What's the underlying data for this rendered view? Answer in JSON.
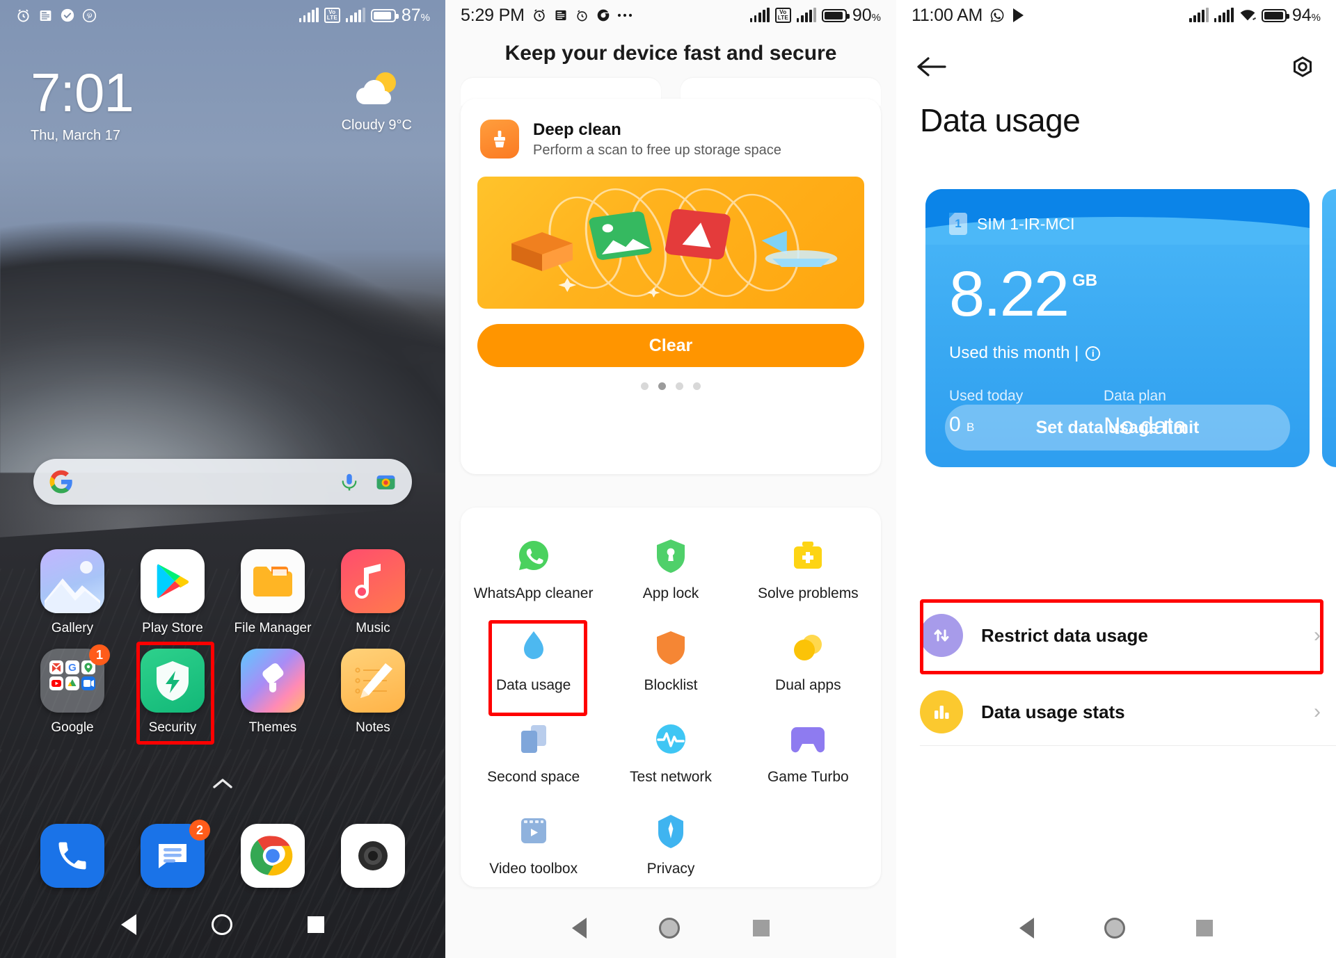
{
  "panel1": {
    "name": "home-screen",
    "statusbar": {
      "icons": [
        "alarm-icon",
        "news-icon",
        "check-circle-icon",
        "pinterest-icon"
      ],
      "signal1": "signal-bars-icon",
      "volte": "VoLTE",
      "volte_top": "Vo",
      "volte_bottom": "LTE",
      "signal2": "signal-bars-icon",
      "battery": "battery-icon",
      "battery_pct": "87",
      "pct_sign": "%"
    },
    "clock": {
      "time": "7:01",
      "date": "Thu, March 17"
    },
    "weather": {
      "condition": "Cloudy",
      "temp": "9°C",
      "label": "Cloudy  9°C",
      "icon": "partly-cloudy-icon"
    },
    "search": {
      "placeholder": "",
      "google_icon": "google-g-icon",
      "mic_icon": "microphone-icon",
      "lens_icon": "google-lens-icon"
    },
    "apps_row1": [
      {
        "label": "Gallery",
        "icon": "gallery-icon"
      },
      {
        "label": "Play Store",
        "icon": "play-store-icon"
      },
      {
        "label": "File Manager",
        "icon": "file-manager-icon"
      },
      {
        "label": "Music",
        "icon": "music-icon"
      }
    ],
    "apps_row2": [
      {
        "label": "Google",
        "icon": "google-folder-icon",
        "badge": "1"
      },
      {
        "label": "Security",
        "icon": "security-shield-icon",
        "highlight": true
      },
      {
        "label": "Themes",
        "icon": "themes-icon"
      },
      {
        "label": "Notes",
        "icon": "notes-icon"
      }
    ],
    "dock": [
      {
        "label": "Phone",
        "icon": "phone-icon"
      },
      {
        "label": "Messages",
        "icon": "messages-icon",
        "badge": "2"
      },
      {
        "label": "Chrome",
        "icon": "chrome-icon"
      },
      {
        "label": "Camera",
        "icon": "camera-icon"
      }
    ],
    "page_indicator_icon": "chevron-up-icon",
    "navbar": [
      "back-nav-icon",
      "home-nav-icon",
      "recents-nav-icon"
    ]
  },
  "panel2": {
    "name": "security-app",
    "statusbar": {
      "time": "5:29 PM",
      "icons": [
        "alarm-icon",
        "news-icon",
        "clock-icon",
        "chrome-icon",
        "more-dots-icon"
      ],
      "volte_top": "Vo",
      "volte_bottom": "LTE",
      "battery_pct": "90",
      "pct_sign": "%"
    },
    "header": "Keep your device fast and secure",
    "deep_clean": {
      "title": "Deep clean",
      "subtitle": "Perform a scan to free up storage space",
      "icon": "broom-icon",
      "banner_icon": "storage-files-banner",
      "button": "Clear",
      "pager_dots": 4,
      "pager_active_index": 1
    },
    "features_row1": [
      {
        "label": "WhatsApp cleaner",
        "icon": "whatsapp-icon"
      },
      {
        "label": "App lock",
        "icon": "app-lock-shield-icon"
      },
      {
        "label": "Solve problems",
        "icon": "first-aid-kit-icon"
      }
    ],
    "features_row2": [
      {
        "label": "Data usage",
        "icon": "water-drop-icon",
        "highlight": true
      },
      {
        "label": "Blocklist",
        "icon": "blocklist-shield-icon"
      },
      {
        "label": "Dual apps",
        "icon": "dual-apps-icon"
      }
    ],
    "features_row3": [
      {
        "label": "Second space",
        "icon": "second-space-icon"
      },
      {
        "label": "Test network",
        "icon": "test-network-icon"
      },
      {
        "label": "Game Turbo",
        "icon": "game-turbo-icon"
      }
    ],
    "features_row4": [
      {
        "label": "Video toolbox",
        "icon": "video-toolbox-icon"
      },
      {
        "label": "Privacy",
        "icon": "privacy-icon"
      }
    ],
    "navbar": [
      "back-nav-icon",
      "home-nav-icon",
      "recents-nav-icon"
    ]
  },
  "panel3": {
    "name": "data-usage-screen",
    "statusbar": {
      "time": "11:00 AM",
      "icons": [
        "whatsapp-icon",
        "play-store-icon"
      ],
      "battery_pct": "94",
      "pct_sign": "%",
      "wifi": "wifi-icon"
    },
    "back_icon": "back-arrow-icon",
    "settings_icon": "gear-icon",
    "title": "Data usage",
    "sim_card": {
      "sim_badge": "1",
      "sim_name": "SIM 1-IR-MCI",
      "amount": "8.22",
      "unit": "GB",
      "used_label": "Used this month |",
      "info_icon": "info-icon",
      "used_today_label": "Used today",
      "used_today_value": "0",
      "used_today_unit": "B",
      "data_plan_label": "Data plan",
      "data_plan_value": "No data",
      "set_limit_button": "Set data usage limit"
    },
    "list": [
      {
        "label": "Restrict data usage",
        "icon": "restrict-data-icon",
        "highlight": true,
        "chevron": "›"
      },
      {
        "label": "Data usage stats",
        "icon": "stats-bar-icon",
        "highlight": false,
        "chevron": "›"
      }
    ],
    "navbar": [
      "back-nav-icon",
      "home-nav-icon",
      "recents-nav-icon"
    ]
  },
  "colors": {
    "red_highlight": "#ff0000",
    "orange_accent": "#ff9500",
    "blue_card": "#3aa9f2",
    "security_green": "#1fc07c",
    "purple": "#a79bea",
    "yellow": "#fbc02d"
  }
}
